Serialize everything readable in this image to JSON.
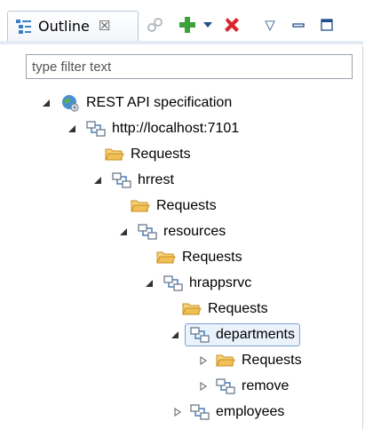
{
  "view": {
    "title": "Outline",
    "close_glyph": "☒"
  },
  "toolbar": {
    "buttons": [
      "link-icon",
      "add-icon",
      "dropdown-icon",
      "delete-icon"
    ],
    "menu_glyph": "▽",
    "minimize_glyph": "▭",
    "maximize_glyph": "□"
  },
  "filter": {
    "placeholder": "type filter text",
    "value": ""
  },
  "tree": {
    "root": "REST API specification",
    "host": "http://localhost:7101",
    "requests": "Requests",
    "hrrest": "hrrest",
    "resources": "resources",
    "hrappsrvc": "hrappsrvc",
    "departments": "departments",
    "remove": "remove",
    "employees": "employees"
  },
  "colors": {
    "accent": "#7da2ce",
    "folder": "#e8b04a",
    "add": "#3ca23c",
    "delete": "#d8262c"
  }
}
